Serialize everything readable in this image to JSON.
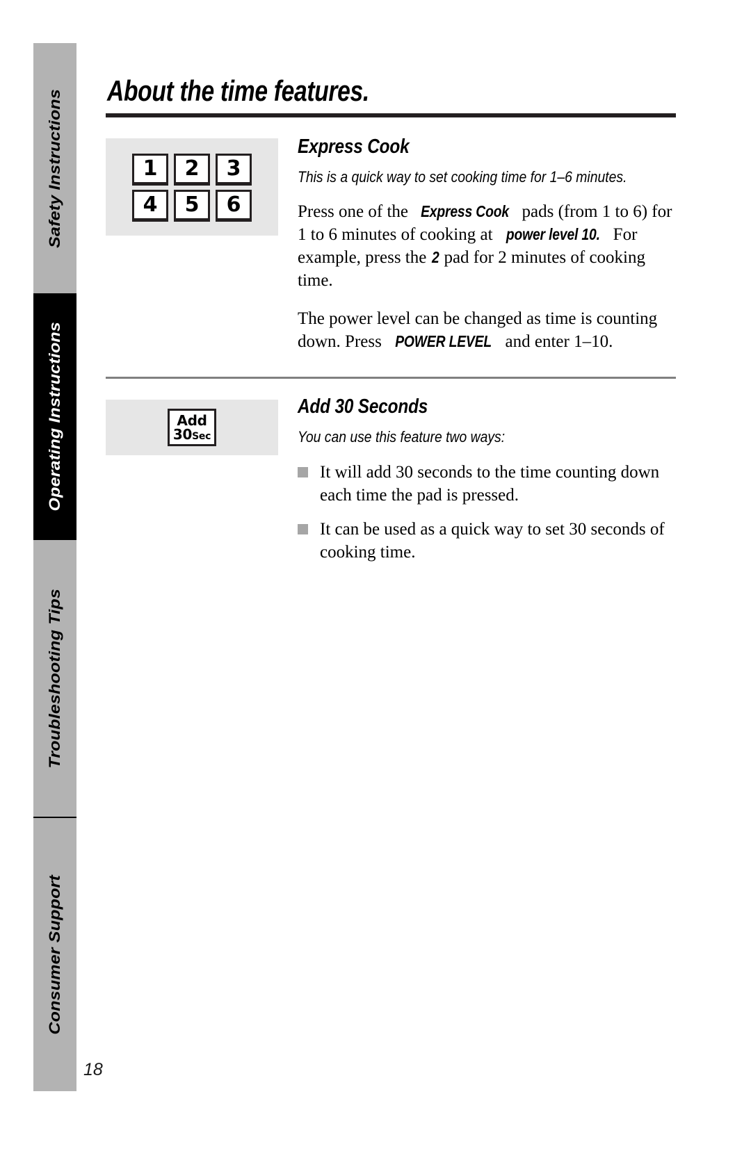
{
  "document": {
    "page_number": "18",
    "title": "About the time features."
  },
  "sidebar": {
    "tabs": [
      {
        "label": "Safety Instructions",
        "state": "inactive"
      },
      {
        "label": "Operating Instructions",
        "state": "active"
      },
      {
        "label": "Troubleshooting Tips",
        "state": "inactive"
      },
      {
        "label": "Consumer Support",
        "state": "inactive"
      }
    ]
  },
  "sections": {
    "express_cook": {
      "heading": "Express Cook",
      "subtitle": "This is a quick way to set cooking time for 1–6 minutes.",
      "keypad": {
        "keys": [
          "1",
          "2",
          "3",
          "4",
          "5",
          "6"
        ]
      },
      "paragraph_1": {
        "part_1": "Press one of the ",
        "emphasis_1": "Express Cook",
        "part_2": "  pads (from 1 to 6) for 1 to 6 minutes of cooking at ",
        "emphasis_2": "power level 10.",
        "part_3": " For example, press the ",
        "emphasis_3": "2",
        "part_4": "  pad for 2 minutes of cooking time."
      },
      "paragraph_2": {
        "part_1": "The power level can be changed as time is counting down. Press ",
        "emphasis_1": "POWER LEVEL",
        "part_2": " and enter 1–10."
      }
    },
    "add_30_seconds": {
      "heading": "Add 30 Seconds",
      "subtitle": "You can use this feature two ways:",
      "pad": {
        "line_1": "Add",
        "line_2_number": "30",
        "line_2_unit": "Sec"
      },
      "bullets": [
        "It will add 30 seconds to the time counting down each time the pad is pressed.",
        "It can be used as a quick way to set 30 seconds of cooking time."
      ]
    }
  }
}
